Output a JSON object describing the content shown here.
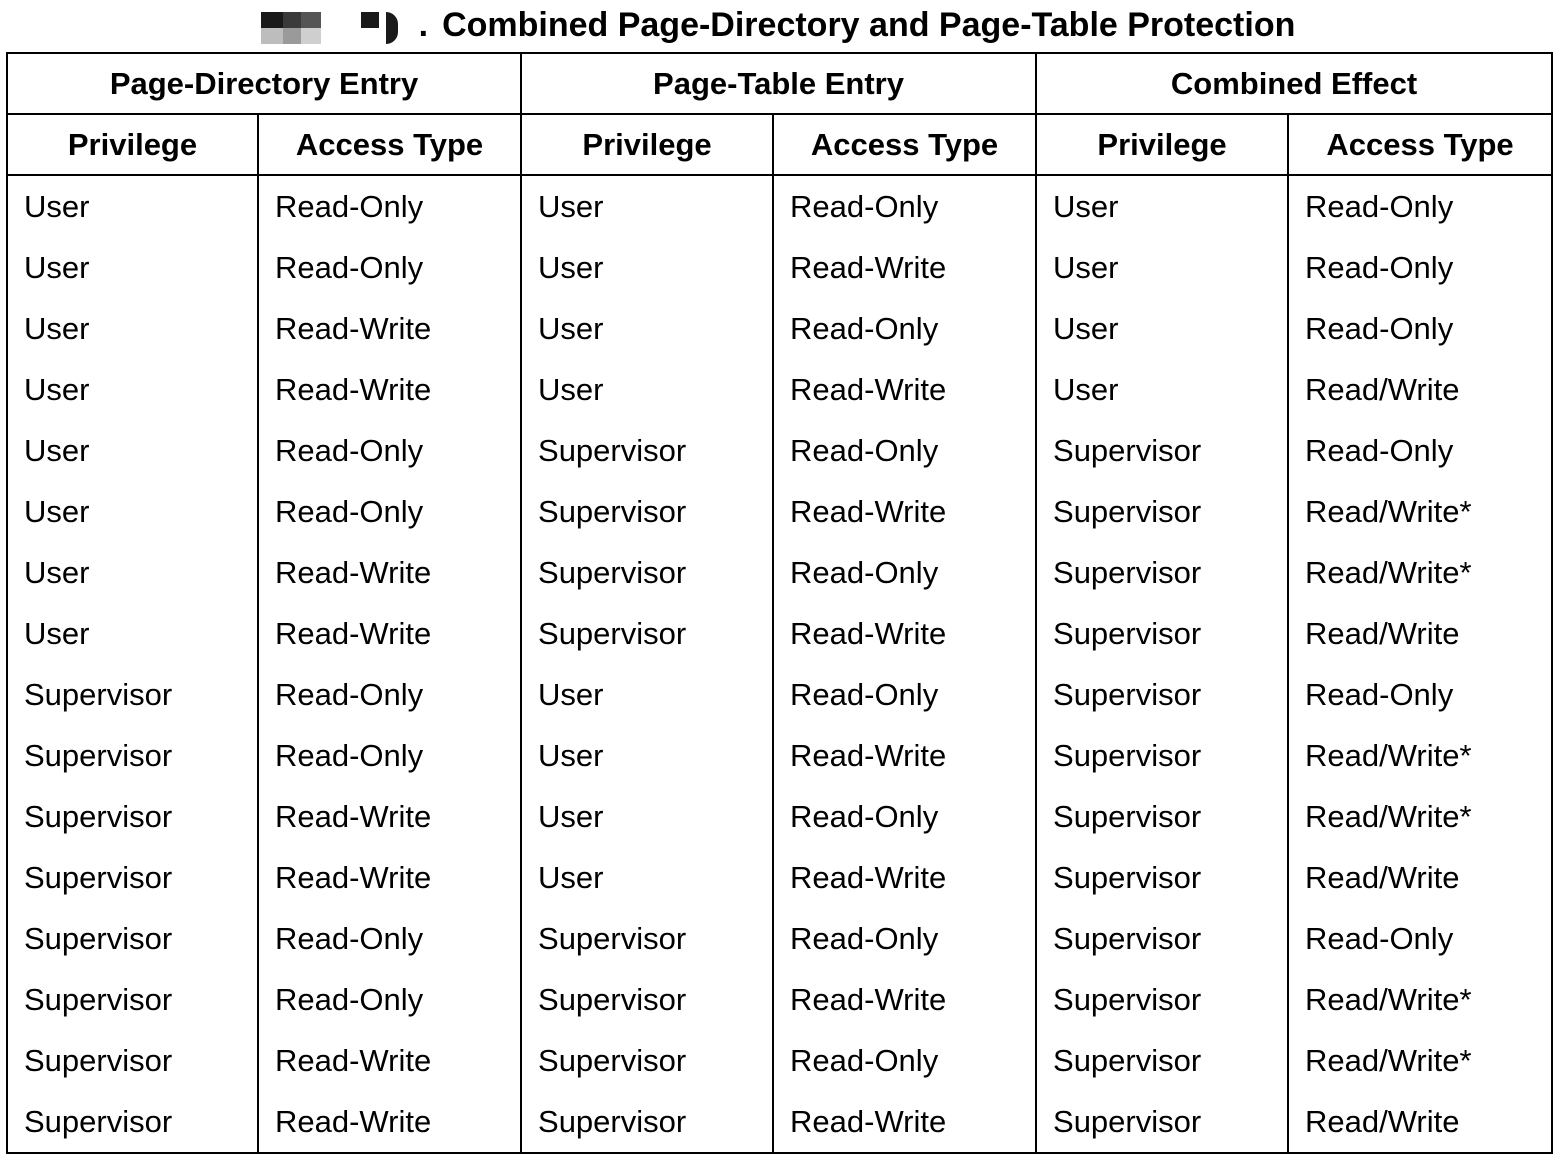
{
  "caption": {
    "text": "Combined Page-Directory and Page-Table Protection"
  },
  "table": {
    "groups": [
      "Page-Directory Entry",
      "Page-Table Entry",
      "Combined Effect"
    ],
    "subheaders": [
      "Privilege",
      "Access Type",
      "Privilege",
      "Access Type",
      "Privilege",
      "Access Type"
    ],
    "rows": [
      [
        "User",
        "Read-Only",
        "User",
        "Read-Only",
        "User",
        "Read-Only"
      ],
      [
        "User",
        "Read-Only",
        "User",
        "Read-Write",
        "User",
        "Read-Only"
      ],
      [
        "User",
        "Read-Write",
        "User",
        "Read-Only",
        "User",
        "Read-Only"
      ],
      [
        "User",
        "Read-Write",
        "User",
        "Read-Write",
        "User",
        "Read/Write"
      ],
      [
        "User",
        "Read-Only",
        "Supervisor",
        "Read-Only",
        "Supervisor",
        "Read-Only"
      ],
      [
        "User",
        "Read-Only",
        "Supervisor",
        "Read-Write",
        "Supervisor",
        "Read/Write*"
      ],
      [
        "User",
        "Read-Write",
        "Supervisor",
        "Read-Only",
        "Supervisor",
        "Read/Write*"
      ],
      [
        "User",
        "Read-Write",
        "Supervisor",
        "Read-Write",
        "Supervisor",
        "Read/Write"
      ],
      [
        "Supervisor",
        "Read-Only",
        "User",
        "Read-Only",
        "Supervisor",
        "Read-Only"
      ],
      [
        "Supervisor",
        "Read-Only",
        "User",
        "Read-Write",
        "Supervisor",
        "Read/Write*"
      ],
      [
        "Supervisor",
        "Read-Write",
        "User",
        "Read-Only",
        "Supervisor",
        "Read/Write*"
      ],
      [
        "Supervisor",
        "Read-Write",
        "User",
        "Read-Write",
        "Supervisor",
        "Read/Write"
      ],
      [
        "Supervisor",
        "Read-Only",
        "Supervisor",
        "Read-Only",
        "Supervisor",
        "Read-Only"
      ],
      [
        "Supervisor",
        "Read-Only",
        "Supervisor",
        "Read-Write",
        "Supervisor",
        "Read/Write*"
      ],
      [
        "Supervisor",
        "Read-Write",
        "Supervisor",
        "Read-Only",
        "Supervisor",
        "Read/Write*"
      ],
      [
        "Supervisor",
        "Read-Write",
        "Supervisor",
        "Read-Write",
        "Supervisor",
        "Read/Write"
      ]
    ]
  }
}
